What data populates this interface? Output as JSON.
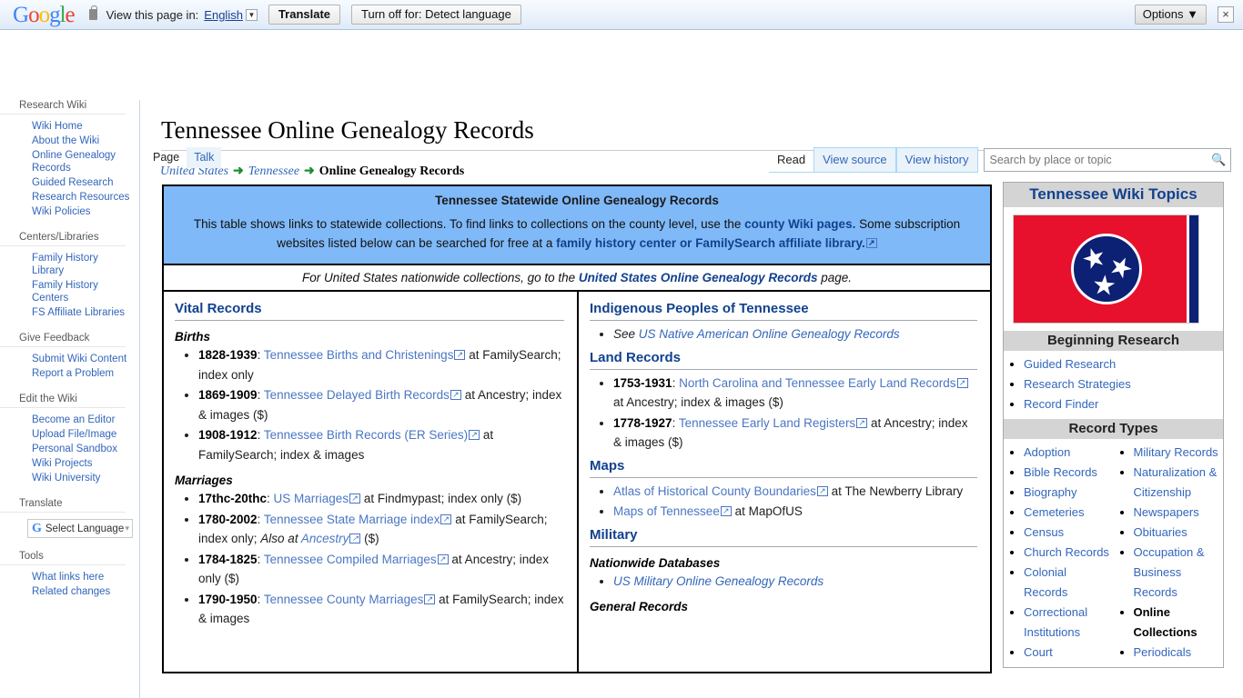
{
  "translate_bar": {
    "logo": "Google",
    "lock_icon": "lock-icon",
    "prompt": "View this page in:",
    "language": "English",
    "translate_button": "Translate",
    "turn_off_button": "Turn off for: Detect language",
    "options_button": "Options ▼",
    "close_icon": "×"
  },
  "sidebar": {
    "groups": [
      {
        "heading": "Research Wiki",
        "items": [
          "Wiki Home",
          "About the Wiki",
          "Online Genealogy Records",
          "Guided Research",
          "Research Resources",
          "Wiki Policies"
        ]
      },
      {
        "heading": "Centers/Libraries",
        "items": [
          "Family History Library",
          "Family History Centers",
          "FS Affiliate Libraries"
        ]
      },
      {
        "heading": "Give Feedback",
        "items": [
          "Submit Wiki Content",
          "Report a Problem"
        ]
      },
      {
        "heading": "Edit the Wiki",
        "items": [
          "Become an Editor",
          "Upload File/Image",
          "Personal Sandbox",
          "Wiki Projects",
          "Wiki University"
        ]
      },
      {
        "heading": "Translate",
        "items": []
      },
      {
        "heading": "Tools",
        "items": [
          "What links here",
          "Related changes"
        ]
      }
    ],
    "select_language": "Select Language"
  },
  "header": {
    "title": "Tennessee Online Genealogy Records",
    "tabs_left": [
      {
        "label": "Page",
        "active": true
      },
      {
        "label": "Talk",
        "active": false
      }
    ],
    "tabs_right": [
      {
        "label": "Read",
        "active": true
      },
      {
        "label": "View source",
        "active": false
      },
      {
        "label": "View history",
        "active": false
      }
    ],
    "search_placeholder": "Search by place or topic",
    "search_value": "",
    "search_icon": "search-icon"
  },
  "breadcrumb": {
    "items": [
      "United States",
      "Tennessee"
    ],
    "current": "Online Genealogy Records",
    "arrow": "➜"
  },
  "infobox": {
    "title": "Tennessee Statewide Online Genealogy Records",
    "text_1": "This table shows links to statewide collections. To find links to collections on the county level, use the ",
    "link_1": "county Wiki pages.",
    "text_2": " Some subscription websites listed below can be searched for free at a ",
    "link_2": "family history center or FamilySearch affiliate library.",
    "background_color": "#80b9f8"
  },
  "nationwide_note": {
    "text_before": "For United States nationwide collections, go to the ",
    "link": "United States Online Genealogy Records",
    "text_after": " page."
  },
  "columns": [
    {
      "sections": [
        {
          "heading": "Vital Records",
          "subsections": [
            {
              "subheading": "Births",
              "entries": [
                {
                  "years": "1828-1939",
                  "link": "Tennessee Births and Christenings",
                  "external": true,
                  "tail": " at FamilySearch; index only"
                },
                {
                  "years": "1869-1909",
                  "link": "Tennessee Delayed Birth Records",
                  "external": true,
                  "tail": " at Ancestry; index & images ($)"
                },
                {
                  "years": "1908-1912",
                  "link": "Tennessee Birth Records (ER Series)",
                  "external": true,
                  "tail": " at FamilySearch; index & images"
                }
              ]
            },
            {
              "subheading": "Marriages",
              "entries": [
                {
                  "years": "17thc-20thc",
                  "link": "US Marriages",
                  "external": true,
                  "tail": " at Findmypast; index only ($)"
                },
                {
                  "years": "1780-2002",
                  "link": "Tennessee State Marriage index",
                  "external": true,
                  "tail": " at FamilySearch; index only; ",
                  "italic_tail": "Also at ",
                  "italic_link": "Ancestry",
                  "italic_after": " ($)"
                },
                {
                  "years": "1784-1825",
                  "link": "Tennessee Compiled Marriages",
                  "external": true,
                  "tail": " at Ancestry; index only ($)"
                },
                {
                  "years": "1790-1950",
                  "link": "Tennessee County Marriages",
                  "external": true,
                  "tail": " at FamilySearch; index & images"
                }
              ]
            }
          ]
        }
      ]
    },
    {
      "sections": [
        {
          "heading": "Indigenous Peoples of Tennessee",
          "subsections": [
            {
              "subheading": "",
              "entries": [
                {
                  "years": "",
                  "prefix_italic": "See ",
                  "link": "US Native American Online Genealogy Records",
                  "external": false,
                  "italic": true,
                  "tail": ""
                }
              ]
            }
          ]
        },
        {
          "heading": "Land Records",
          "subsections": [
            {
              "subheading": "",
              "entries": [
                {
                  "years": "1753-1931",
                  "link": "North Carolina and Tennessee Early Land Records",
                  "external": true,
                  "tail": " at Ancestry; index & images ($)"
                },
                {
                  "years": "1778-1927",
                  "link": "Tennessee Early Land Registers",
                  "external": true,
                  "tail": " at Ancestry; index & images ($)"
                }
              ]
            }
          ]
        },
        {
          "heading": "Maps",
          "subsections": [
            {
              "subheading": "",
              "entries": [
                {
                  "years": "",
                  "link": "Atlas of Historical County Boundaries",
                  "external": true,
                  "tail": " at The Newberry Library"
                },
                {
                  "years": "",
                  "link": "Maps of Tennessee",
                  "external": true,
                  "tail": " at MapOfUS"
                }
              ]
            }
          ]
        },
        {
          "heading": "Military",
          "subsections": [
            {
              "subheading": "Nationwide Databases",
              "entries": [
                {
                  "years": "",
                  "link": "US Military Online Genealogy Records",
                  "external": false,
                  "italic": true,
                  "tail": ""
                }
              ]
            },
            {
              "subheading": "General Records",
              "entries": []
            }
          ]
        }
      ]
    }
  ],
  "topics": {
    "title": "Tennessee Wiki Topics",
    "flag_alt": "tennessee-flag",
    "sections": [
      {
        "title": "Beginning Research",
        "layout": "single",
        "items": [
          {
            "label": "Guided Research",
            "bold": false
          },
          {
            "label": "Research Strategies",
            "bold": false
          },
          {
            "label": "Record Finder",
            "bold": false
          }
        ]
      },
      {
        "title": "Record Types",
        "layout": "double",
        "left_items": [
          {
            "label": "Adoption",
            "bold": false
          },
          {
            "label": "Bible Records",
            "bold": false
          },
          {
            "label": "Biography",
            "bold": false
          },
          {
            "label": "Cemeteries",
            "bold": false
          },
          {
            "label": "Census",
            "bold": false
          },
          {
            "label": "Church Records",
            "bold": false
          },
          {
            "label": "Colonial Records",
            "bold": false
          },
          {
            "label": "Correctional Institutions",
            "bold": false
          },
          {
            "label": "Court",
            "bold": false
          }
        ],
        "right_items": [
          {
            "label": "Military Records",
            "bold": false
          },
          {
            "label": "Naturalization & Citizenship",
            "bold": false
          },
          {
            "label": "Newspapers",
            "bold": false
          },
          {
            "label": "Obituaries",
            "bold": false
          },
          {
            "label": "Occupation & Business Records",
            "bold": false
          },
          {
            "label": "Online Collections",
            "bold": true
          },
          {
            "label": "Periodicals",
            "bold": false
          }
        ]
      }
    ]
  }
}
